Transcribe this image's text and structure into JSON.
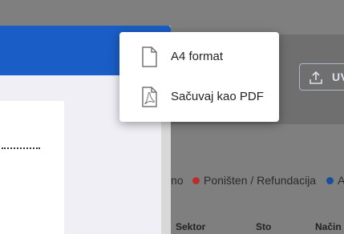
{
  "menu": {
    "items": [
      {
        "label": "A4 format",
        "icon": "file-icon"
      },
      {
        "label": "Sačuvaj kao PDF",
        "icon": "pdf-file-icon"
      }
    ]
  },
  "toolbar": {
    "upload_label": "UV"
  },
  "legend": {
    "partial_left": "no",
    "cancelled": "Poništen / Refundacija",
    "partial_right": "A"
  },
  "table": {
    "headers": [
      "Sektor",
      "Sto",
      "Način p"
    ]
  },
  "colors": {
    "header_blue": "#1a5dc6",
    "cancelled_red": "#b82f2f",
    "legend_blue": "#1a4d9c"
  }
}
